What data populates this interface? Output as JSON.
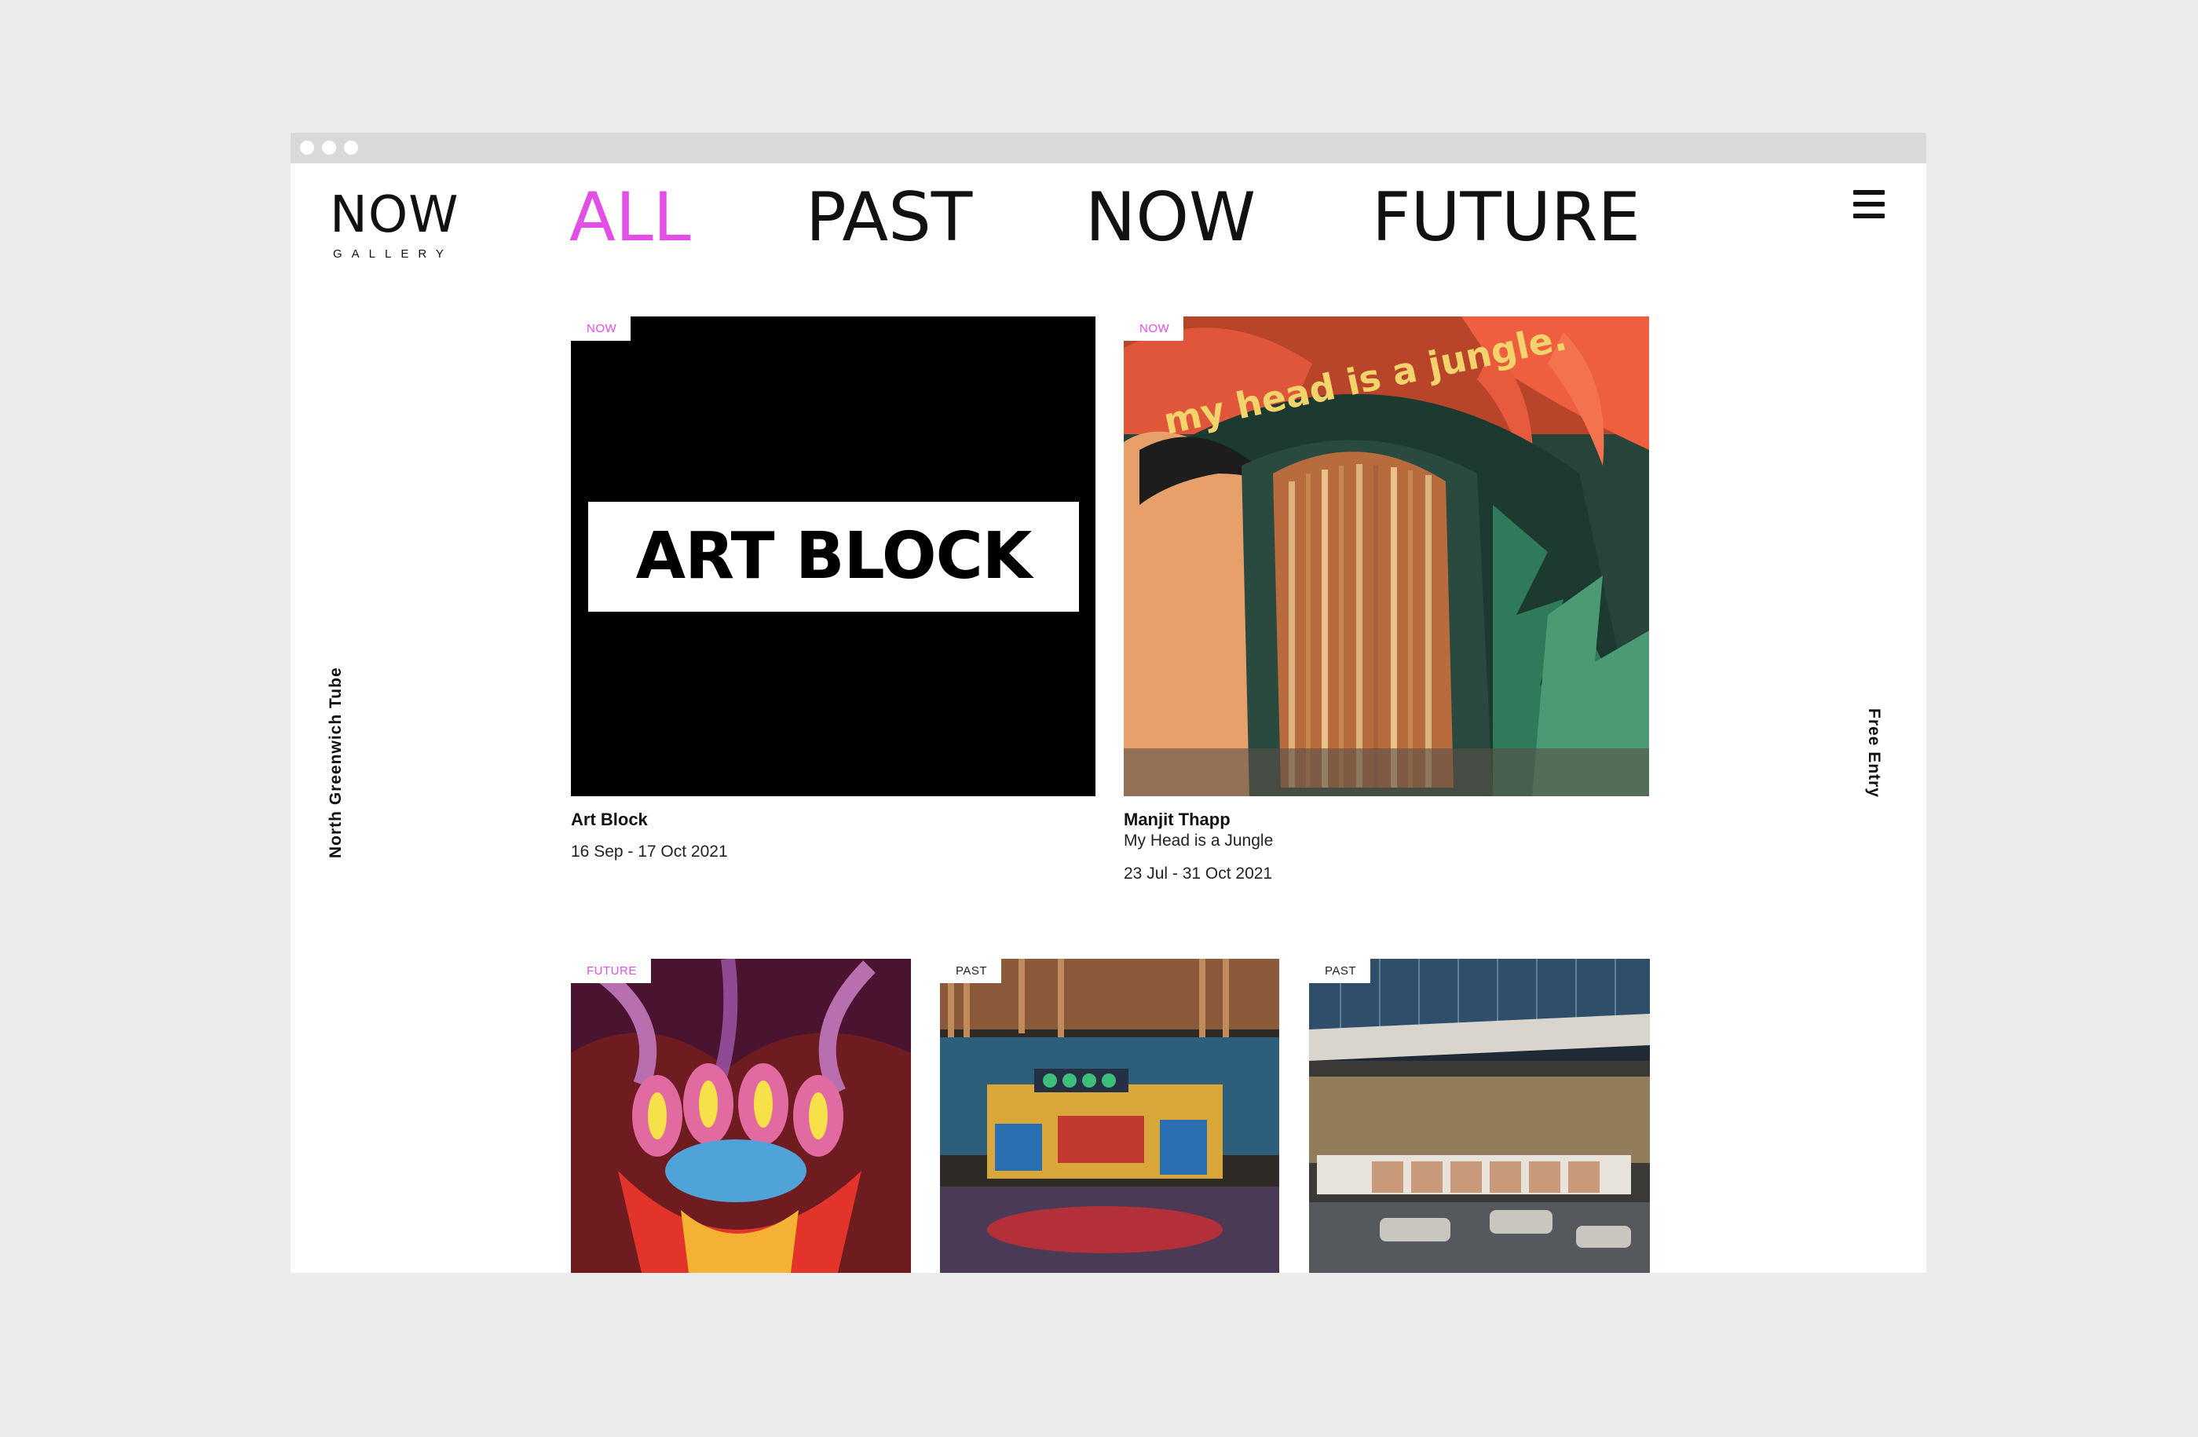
{
  "window": {
    "dots": 3
  },
  "logo": {
    "word": "NOW",
    "sub": "GALLERY"
  },
  "nav": {
    "items": [
      {
        "label": "ALL",
        "active": true
      },
      {
        "label": "PAST",
        "active": false
      },
      {
        "label": "NOW",
        "active": false
      },
      {
        "label": "FUTURE",
        "active": false
      }
    ],
    "menu_icon": "hamburger-menu-icon"
  },
  "side": {
    "left": "North Greenwich Tube",
    "right": "Free Entry"
  },
  "accent_color": "#e14fe6",
  "exhibitions": [
    {
      "tag": "NOW",
      "image_text": "ART BLOCK",
      "title": "Art Block",
      "date": "16 Sep - 17 Oct 2021"
    },
    {
      "tag": "NOW",
      "image_text": "my head is a jungle.",
      "title": "Manjit Thapp",
      "subtitle": "My Head is a Jungle",
      "date": "23 Jul - 31 Oct 2021"
    },
    {
      "tag": "FUTURE"
    },
    {
      "tag": "PAST"
    },
    {
      "tag": "PAST"
    }
  ]
}
